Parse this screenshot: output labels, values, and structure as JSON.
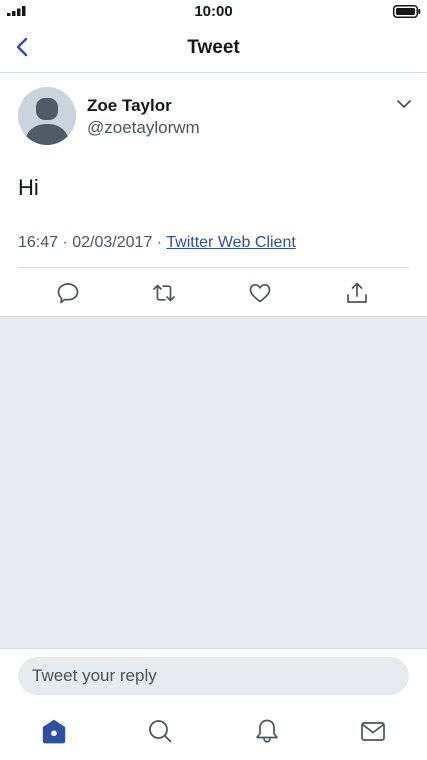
{
  "status_bar": {
    "time": "10:00"
  },
  "header": {
    "title": "Tweet",
    "back_icon": "chevron-left-icon"
  },
  "tweet": {
    "user_name": "Zoe Taylor",
    "user_handle": "@zoetaylorwm",
    "text": "Hi",
    "timestamp": "16:47 · 02/03/2017 · ",
    "source": "Twitter Web Client",
    "actions": [
      "reply-icon",
      "retweet-icon",
      "like-icon",
      "share-icon"
    ]
  },
  "reply": {
    "placeholder": "Tweet your reply"
  },
  "tab_bar": {
    "tabs": [
      "home-icon",
      "search-icon",
      "notifications-icon",
      "messages-icon"
    ]
  },
  "colors": {
    "accent": "#2f4fa0",
    "text_primary": "#14171a",
    "text_secondary": "#4a5561",
    "background_gray": "#e6ebef",
    "divider": "#d6dbe0"
  }
}
